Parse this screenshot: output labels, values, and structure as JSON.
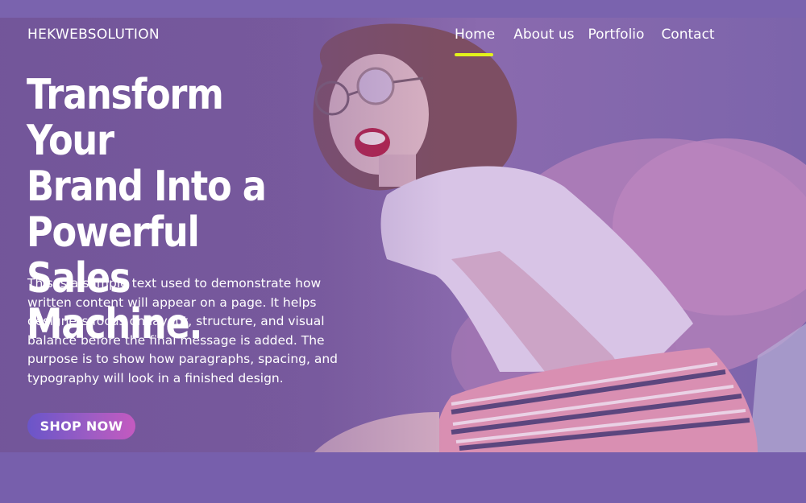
{
  "brand": {
    "logo_text": "HEKWEBSOLUTION"
  },
  "nav": {
    "items": [
      {
        "label": "Home",
        "active": true
      },
      {
        "label": "About us",
        "active": false
      },
      {
        "label": "Portfolio",
        "active": false
      },
      {
        "label": "Contact",
        "active": false
      }
    ]
  },
  "hero": {
    "title_lines": [
      "Transform Your",
      "Brand Into a",
      "Powerful Sales",
      "Machine."
    ],
    "body": "This is a sample text used to demonstrate how written content will appear on a page. It helps designers focus on layout, structure, and visual balance before the final message is added. The purpose is to show how paragraphs, spacing, and typography will look in a finished design.",
    "cta_label": "SHOP NOW"
  },
  "colors": {
    "page_background": "#7660ab",
    "active_underline": "#e3f21a",
    "cta_gradient_start": "#6a55c9",
    "cta_gradient_end": "#c45ac0"
  },
  "icons": {
    "hero_image": "woman-in-glasses-on-fluffy-chair-photo"
  }
}
